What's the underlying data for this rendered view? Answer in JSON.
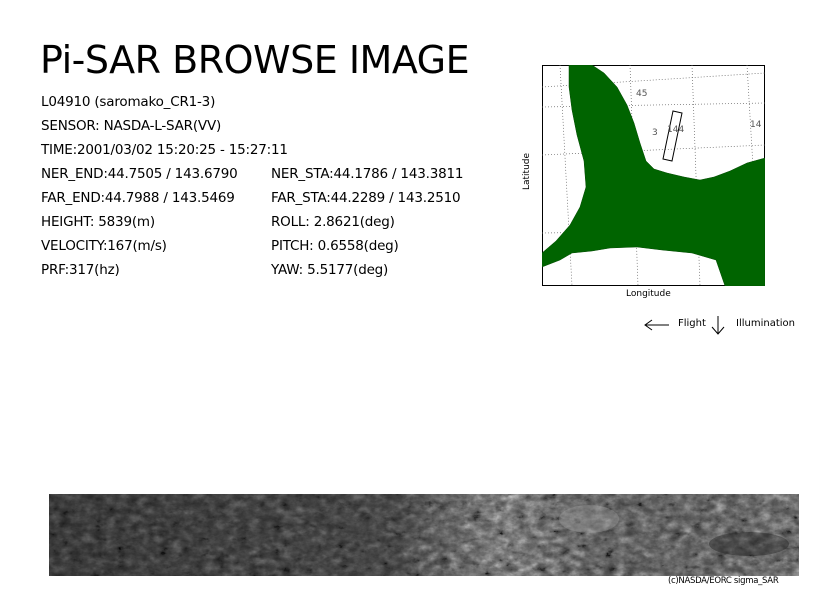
{
  "title": "Pi-SAR BROWSE IMAGE",
  "info": {
    "id": "L04910 (saromako_CR1-3)",
    "sensor": "SENSOR: NASDA-L-SAR(VV)",
    "time": "TIME:2001/03/02  15:20:25 - 15:27:11",
    "ner_end": "NER_END:44.7505 / 143.6790",
    "ner_sta": "NER_STA:44.1786 / 143.3811",
    "far_end": "FAR_END:44.7988 / 143.5469",
    "far_sta": "FAR_STA:44.2289 / 143.2510",
    "height": "HEIGHT: 5839(m)",
    "roll": "ROLL: 2.8621(deg)",
    "velocity": "VELOCITY:167(m/s)",
    "pitch": "PITCH: 0.6558(deg)",
    "prf": "PRF:317(hz)",
    "yaw": "YAW:  5.5177(deg)"
  },
  "map": {
    "grid_labels": [
      "45",
      "144",
      "14",
      "3"
    ],
    "land_color": "#006400",
    "y_axis_label": "Latitude",
    "x_axis_label": "Longitude"
  },
  "legend": {
    "flight_label": "Flight",
    "illumination_label": "Illumination",
    "flight_icon": "arrow-left-icon",
    "illumination_icon": "arrow-down-icon"
  },
  "copyright": "(c)NASDA/EORC sigma_SAR"
}
